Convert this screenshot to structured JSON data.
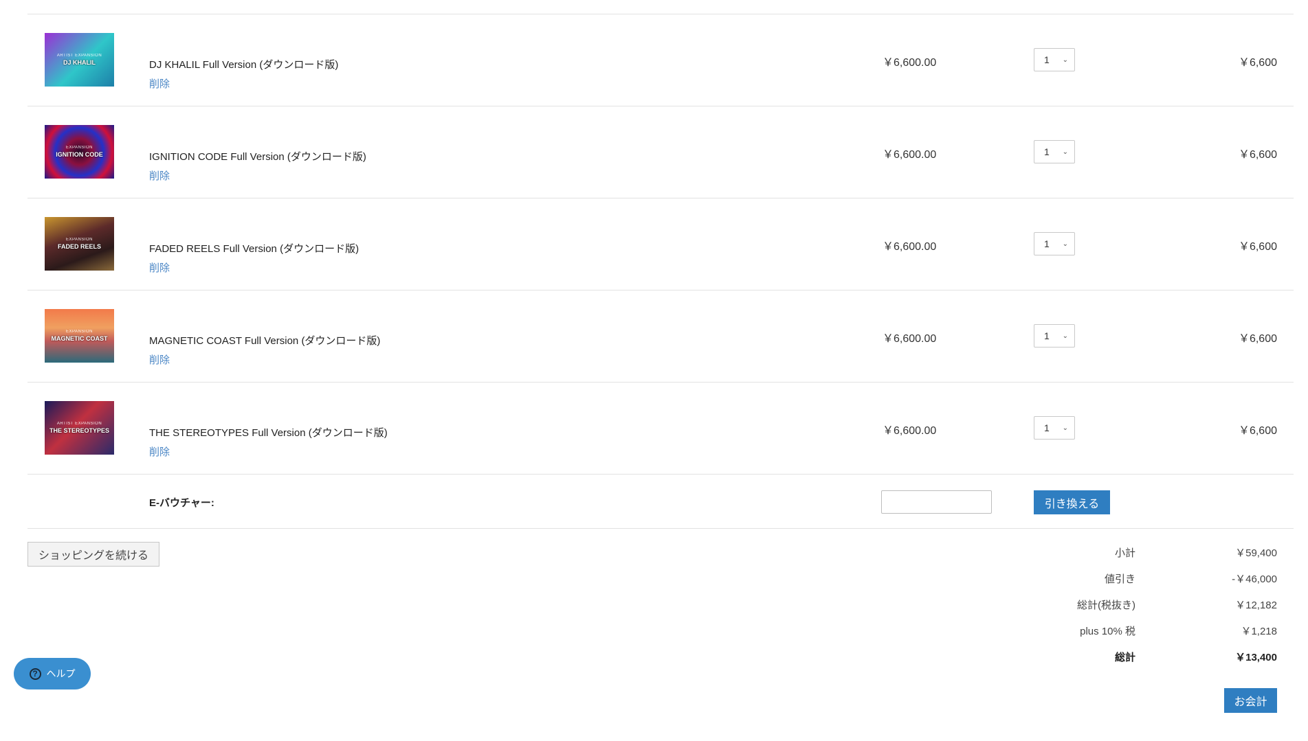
{
  "cart": {
    "items": [
      {
        "thumb_sub": "ARTIST EXPANSION",
        "thumb_title": "DJ KHALIL",
        "name": "DJ KHALIL Full Version (ダウンロード版)",
        "delete_label": "削除",
        "price": "￥6,600.00",
        "quantity": "1",
        "total": "￥6,600"
      },
      {
        "thumb_sub": "EXPANSION",
        "thumb_title": "IGNITION CODE",
        "name": "IGNITION CODE Full Version (ダウンロード版)",
        "delete_label": "削除",
        "price": "￥6,600.00",
        "quantity": "1",
        "total": "￥6,600"
      },
      {
        "thumb_sub": "EXPANSION",
        "thumb_title": "FADED REELS",
        "name": "FADED REELS Full Version (ダウンロード版)",
        "delete_label": "削除",
        "price": "￥6,600.00",
        "quantity": "1",
        "total": "￥6,600"
      },
      {
        "thumb_sub": "EXPANSION",
        "thumb_title": "MAGNETIC COAST",
        "name": "MAGNETIC COAST Full Version (ダウンロード版)",
        "delete_label": "削除",
        "price": "￥6,600.00",
        "quantity": "1",
        "total": "￥6,600"
      },
      {
        "thumb_sub": "ARTIST EXPANSION",
        "thumb_title": "THE STEREOTYPES",
        "name": "THE STEREOTYPES Full Version (ダウンロード版)",
        "delete_label": "削除",
        "price": "￥6,600.00",
        "quantity": "1",
        "total": "￥6,600"
      }
    ]
  },
  "voucher": {
    "label": "E-バウチャー:",
    "input_value": "",
    "redeem_label": "引き換える"
  },
  "continue_shopping_label": "ショッピングを続ける",
  "totals": {
    "subtotal_label": "小計",
    "subtotal_value": "￥59,400",
    "discount_label": "値引き",
    "discount_value": "-￥46,000",
    "net_label": "総計(税抜き)",
    "net_value": "￥12,182",
    "tax_label": "plus 10% 税",
    "tax_value": "￥1,218",
    "grand_label": "総計",
    "grand_value": "￥13,400"
  },
  "checkout_label": "お会計",
  "help": {
    "label": "ヘルプ",
    "icon_glyph": "?"
  },
  "colors": {
    "accent": "#2f7ec1",
    "link": "#4a86c5",
    "help_bubble": "#3a8fd0",
    "divider": "#e2e2e2"
  }
}
